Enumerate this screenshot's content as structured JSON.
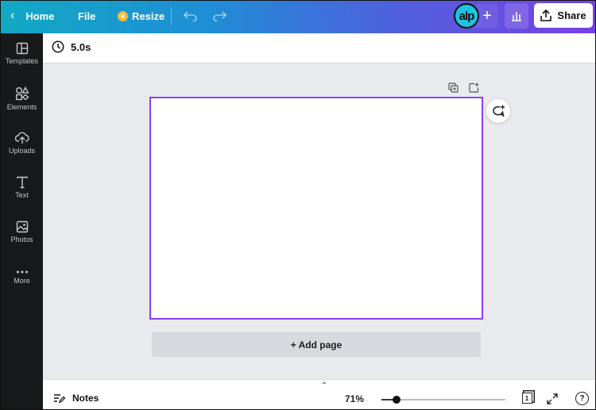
{
  "header": {
    "home_label": "Home",
    "file_label": "File",
    "resize_label": "Resize",
    "avatar_text": "alp",
    "add_label": "+",
    "share_label": "Share"
  },
  "sidebar": {
    "items": [
      {
        "label": "Templates",
        "icon": "templates-icon"
      },
      {
        "label": "Elements",
        "icon": "elements-icon"
      },
      {
        "label": "Uploads",
        "icon": "uploads-icon"
      },
      {
        "label": "Text",
        "icon": "text-icon"
      },
      {
        "label": "Photos",
        "icon": "photos-icon"
      },
      {
        "label": "More",
        "icon": "more-icon"
      }
    ]
  },
  "toolbar": {
    "duration": "5.0s"
  },
  "canvas": {
    "add_page_label": "+ Add page"
  },
  "footer": {
    "notes_label": "Notes",
    "zoom_label": "71%",
    "zoom_level": 0.12,
    "page_count": "1",
    "help_label": "?",
    "expand_glyph": "⌃"
  },
  "colors": {
    "accent": "#8b3dff",
    "sidebar_bg": "#18191b",
    "canvas_bg": "#e9eaee"
  }
}
